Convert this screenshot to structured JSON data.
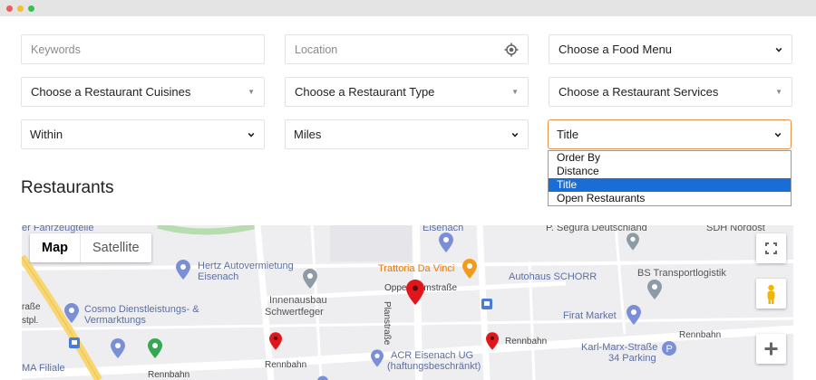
{
  "filters": {
    "keywords_placeholder": "Keywords",
    "location_placeholder": "Location",
    "food_menu": "Choose a Food Menu",
    "cuisines": "Choose a Restaurant Cuisines",
    "type": "Choose a Restaurant Type",
    "services": "Choose a Restaurant Services",
    "within": "Within",
    "units": "Miles",
    "order_by_selected": "Title"
  },
  "order_options": [
    "Order By",
    "Distance",
    "Title",
    "Open Restaurants"
  ],
  "section_title": "Restaurants",
  "map": {
    "map_label": "Map",
    "satellite_label": "Satellite",
    "labels": {
      "fahrzeugteile": "er Fahrzeugteile",
      "eisenach_top": "Eisenach",
      "segura": "P. Segura Deutschland",
      "sdh": "SDH Nordost",
      "hertz_1": "Hertz Autovermietung",
      "hertz_2": "Eisenach",
      "trattoria": "Trattoria Da Vinci",
      "autohaus": "Autohaus SCHORR",
      "bs_transport": "BS Transportlogistik",
      "innenausbau_1": "Innenausbau",
      "innenausbau_2": "Schwertfeger",
      "oppenheimstrasse": "Oppenheimstraße",
      "strasse_left": "raße",
      "stpl": "stpl.",
      "cosmo_1": "Cosmo Dienstleistungs- &",
      "cosmo_2": "Vermarktungs",
      "plan_strasse": "Planstraße",
      "firat": "Firat Market",
      "rennbahn_1": "Rennbahn",
      "rennbahn_2": "Rennbahn",
      "rennbahn_3": "Rennbahn",
      "rennbahn_4": "Rennbahn",
      "acr_1": "ACR Eisenach UG",
      "acr_2": "(haftungsbeschränkt)",
      "karl_marx_1": "Karl-Marx-Straße",
      "karl_marx_2": "34 Parking",
      "filiale": "MA Filiale"
    }
  },
  "icons": {
    "locate": "crosshair-icon",
    "fullscreen": "fullscreen-icon",
    "pegman": "pegman-icon",
    "zoom_in": "plus-icon"
  }
}
